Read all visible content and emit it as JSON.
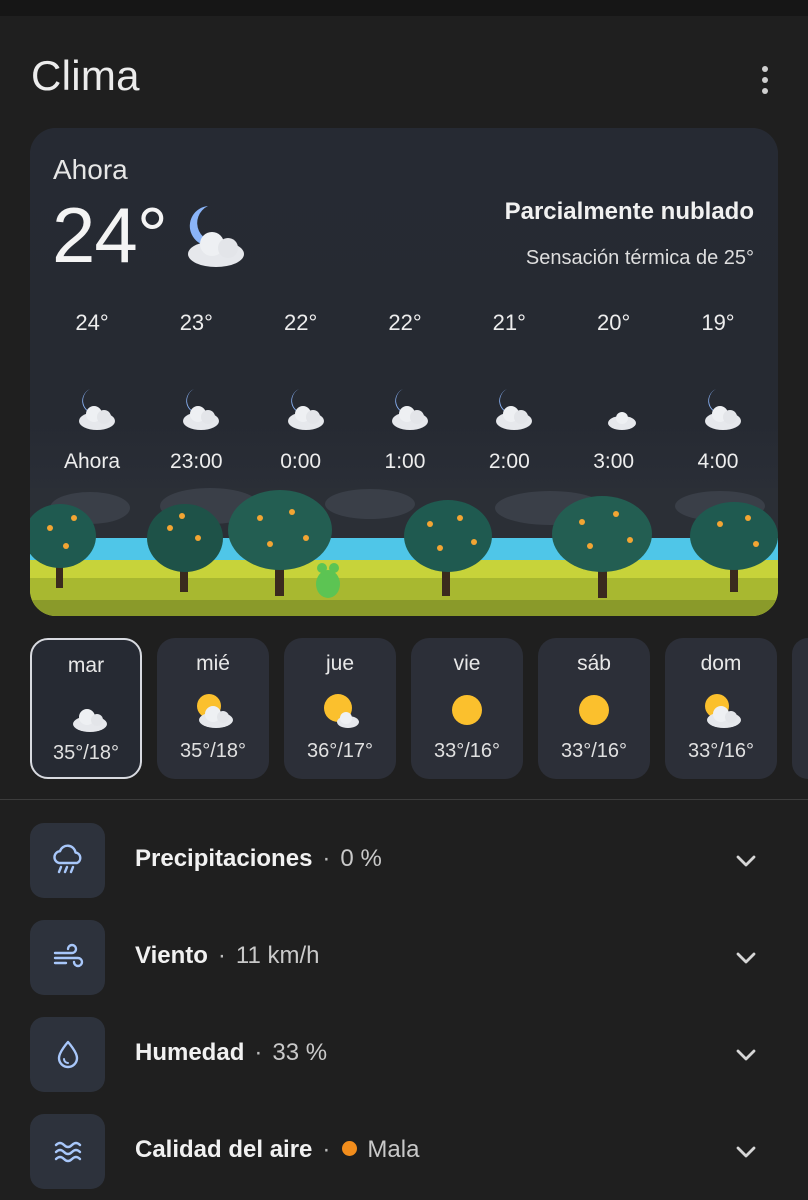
{
  "app": {
    "title": "Clima"
  },
  "now": {
    "label": "Ahora",
    "temperature": "24°",
    "condition": "Parcialmente nublado",
    "feels_like": "Sensación térmica de 25°",
    "icon": "moon-partly-cloudy-icon"
  },
  "hourly": [
    {
      "temp": "24°",
      "time": "Ahora",
      "icon": "moon-partly-cloudy-icon"
    },
    {
      "temp": "23°",
      "time": "23:00",
      "icon": "moon-partly-cloudy-icon"
    },
    {
      "temp": "22°",
      "time": "0:00",
      "icon": "moon-partly-cloudy-icon"
    },
    {
      "temp": "22°",
      "time": "1:00",
      "icon": "moon-partly-cloudy-icon"
    },
    {
      "temp": "21°",
      "time": "2:00",
      "icon": "moon-partly-cloudy-icon"
    },
    {
      "temp": "20°",
      "time": "3:00",
      "icon": "moon-mostly-clear-icon"
    },
    {
      "temp": "19°",
      "time": "4:00",
      "icon": "moon-partly-cloudy-icon"
    }
  ],
  "daily": [
    {
      "day": "mar",
      "range": "35°/18°",
      "icon": "moon-partly-cloudy-icon",
      "selected": true
    },
    {
      "day": "mié",
      "range": "35°/18°",
      "icon": "sun-partly-cloudy-icon"
    },
    {
      "day": "jue",
      "range": "36°/17°",
      "icon": "sun-mostly-sunny-icon"
    },
    {
      "day": "vie",
      "range": "33°/16°",
      "icon": "sun-icon"
    },
    {
      "day": "sáb",
      "range": "33°/16°",
      "icon": "sun-icon"
    },
    {
      "day": "dom",
      "range": "33°/16°",
      "icon": "sun-partly-cloudy-icon"
    }
  ],
  "details": [
    {
      "label": "Precipitaciones",
      "value": "0 %",
      "icon": "rain-icon"
    },
    {
      "label": "Viento",
      "value": "11 km/h",
      "icon": "wind-icon"
    },
    {
      "label": "Humedad",
      "value": "33 %",
      "icon": "drop-icon"
    },
    {
      "label": "Calidad del aire",
      "value": "Mala",
      "icon": "air-quality-icon",
      "status_color": "#f28d1c"
    }
  ],
  "colors": {
    "background": "#1f1f1f",
    "card": "#262a33",
    "moon": "#8ab4f8",
    "sun": "#fbc02d",
    "accent_icon": "#a8c7fa"
  }
}
